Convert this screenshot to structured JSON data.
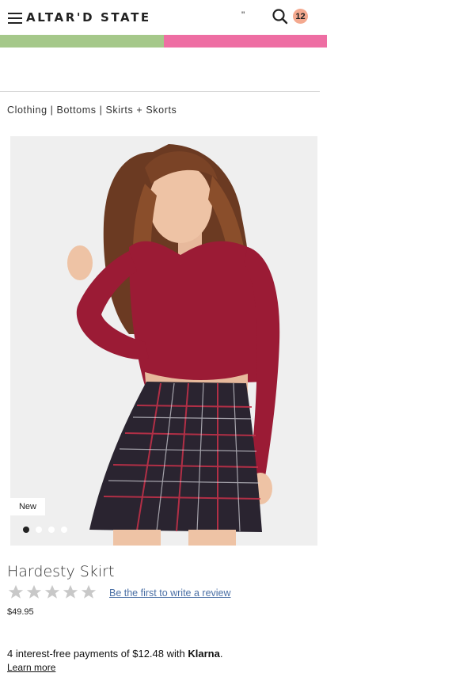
{
  "header": {
    "logo": "ALTAR'D STATE",
    "quote_mark": "\"",
    "bag_count": "12"
  },
  "breadcrumb": {
    "items": [
      "Clothing",
      "Bottoms",
      "Skirts + Skorts"
    ],
    "separator": "|"
  },
  "product": {
    "badge": "New",
    "carousel_dot_count": 4,
    "carousel_active_index": 0,
    "name": "Hardesty Skirt",
    "rating": 0,
    "rating_max": 5,
    "review_link": "Be the first to write a review",
    "price": "$49.95"
  },
  "klarna": {
    "prefix": "4 interest-free payments of $12.48 with",
    "brand": "Klarna",
    "suffix": ".",
    "learn_more": "Learn more"
  },
  "colors": {
    "promo_left": "#a5c88a",
    "promo_right": "#ee6ea3",
    "badge": "#f4a98f",
    "link": "#4a6fa5",
    "top": "#9b1b35",
    "skirt": "#2a2430"
  }
}
